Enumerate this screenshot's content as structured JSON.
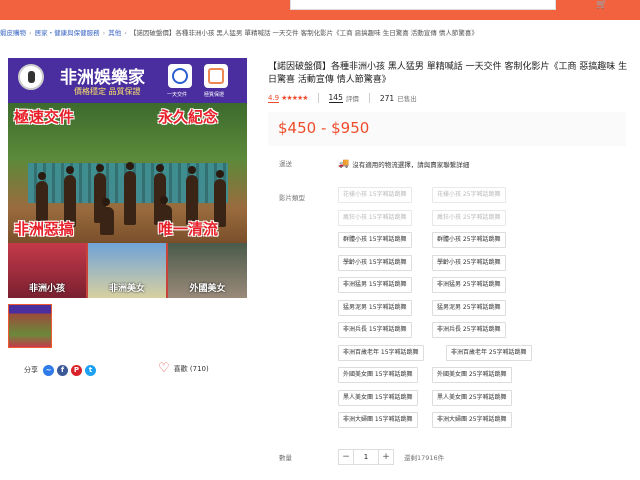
{
  "header": {
    "cart_icon": "cart-icon"
  },
  "breadcrumb": {
    "items": [
      "蝦皮購物",
      "居家・健康與保健服務",
      "其他"
    ],
    "current": "【諾因破盤價】各種非洲小孩 黑人猛男 單精喊話 一天交件 客制化影片《工商 惡搞趣味 生日驚喜 活動宣傳 情人節驚喜》"
  },
  "image": {
    "brand": "非洲娛樂家",
    "slogan": "價格穩定 品質保證",
    "badge1_label": "一天交件",
    "badge2_label": "極質保證",
    "text_top_left": "極速交件",
    "text_top_right": "永久紀念",
    "text_bottom_left": "非洲惡搞",
    "text_bottom_right": "唯一清流",
    "thumb1": "非洲小孩",
    "thumb2": "非洲美女",
    "thumb3": "外國美女"
  },
  "share": {
    "label": "分享",
    "icons": [
      "messenger-icon",
      "facebook-icon",
      "pinterest-icon",
      "twitter-icon"
    ]
  },
  "favorite": {
    "label": "喜歡 (710)"
  },
  "product": {
    "title": "【諾因破盤價】各種非洲小孩 黑人猛男 單精喊話 一天交件 客制化影片《工商 惡搞趣味 生日驚喜 活動宣傳 情人節驚喜》",
    "rating": "4.9",
    "stars": "★★★★★",
    "reviews_count": "145",
    "reviews_label": "評價",
    "sold_count": "271",
    "sold_label": "已售出",
    "price": "$450 - $950"
  },
  "shipping": {
    "label": "運送",
    "text": "沒有適用的物流選擇，請與賣家聯繫詳細"
  },
  "options": {
    "label": "影片類型",
    "items": [
      {
        "text": "花樣小孩 15字喊話跳舞",
        "disabled": true
      },
      {
        "text": "花樣小孩 25字喊話跳舞",
        "disabled": true
      },
      {
        "text": "瘋狂小孩 15字喊話跳舞",
        "disabled": true
      },
      {
        "text": "瘋狂小孩 25字喊話跳舞",
        "disabled": true
      },
      {
        "text": "群體小孩 15字喊話跳舞",
        "disabled": false
      },
      {
        "text": "群體小孩 25字喊話跳舞",
        "disabled": false
      },
      {
        "text": "學齡小孩 15字喊話跳舞",
        "disabled": false
      },
      {
        "text": "學齡小孩 25字喊話跳舞",
        "disabled": false
      },
      {
        "text": "非洲猛男 15字喊話跳舞",
        "disabled": false
      },
      {
        "text": "非洲猛男 25字喊話跳舞",
        "disabled": false
      },
      {
        "text": "猛男泥男 15字喊話跳舞",
        "disabled": false
      },
      {
        "text": "猛男泥男 25字喊話跳舞",
        "disabled": false
      },
      {
        "text": "非洲兵長 15字喊話跳舞",
        "disabled": false
      },
      {
        "text": "非洲兵長 25字喊話跳舞",
        "disabled": false
      },
      {
        "text": "非洲百歲老年 15字喊話跳舞",
        "disabled": false
      },
      {
        "text": "非洲百歲老年 25字喊話跳舞",
        "disabled": false
      },
      {
        "text": "外國美女團 15字喊話跳舞",
        "disabled": false
      },
      {
        "text": "外國美女團 25字喊話跳舞",
        "disabled": false
      },
      {
        "text": "黑人美女團 15字喊話跳舞",
        "disabled": false
      },
      {
        "text": "黑人美女團 25字喊話跳舞",
        "disabled": false
      },
      {
        "text": "非洲大婦團 15字喊話跳舞",
        "disabled": false
      },
      {
        "text": "非洲大婦團 25字喊話跳舞",
        "disabled": false
      }
    ]
  },
  "quantity": {
    "label": "數量",
    "minus": "−",
    "value": "1",
    "plus": "+",
    "stock": "還剩17916件"
  },
  "colors": {
    "accent": "#ee4d2d",
    "topbar": "#f3623f"
  }
}
